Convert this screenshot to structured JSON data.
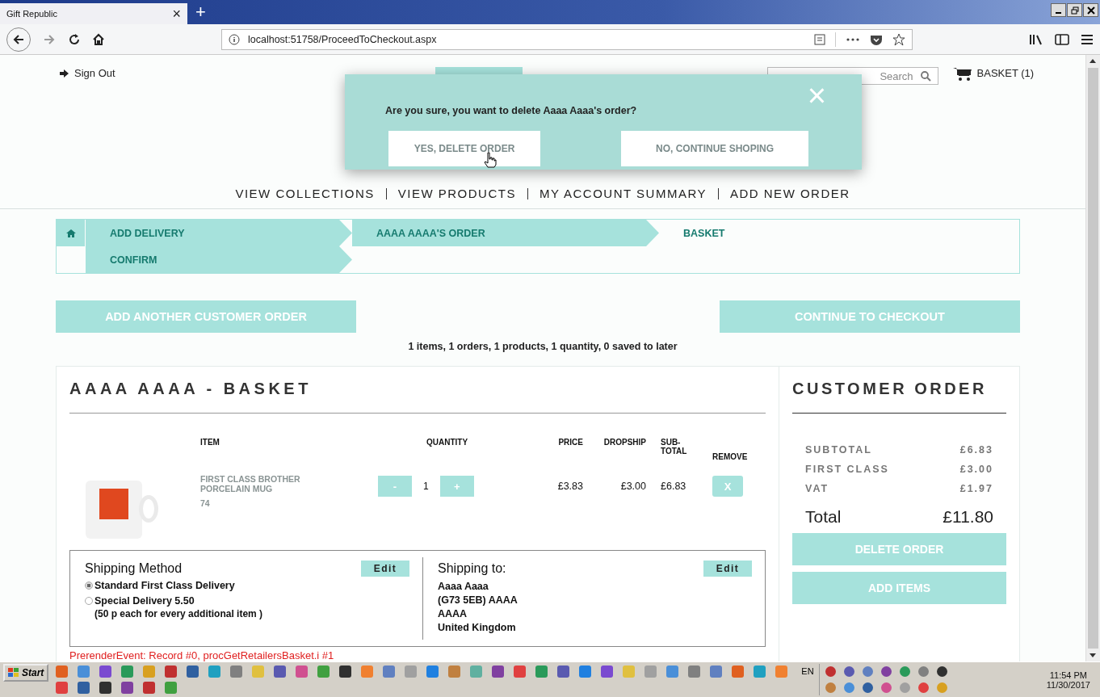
{
  "browser": {
    "tab": {
      "title": "Gift Republic",
      "close": "×"
    },
    "new_tab": "+",
    "url": "localhost:51758/ProceedToCheckout.aspx"
  },
  "header": {
    "sign_out": "Sign Out",
    "search": {
      "placeholder": "Search"
    },
    "basket": "BASKET (1)"
  },
  "dialog": {
    "message": "Are you sure, you want to delete Aaaa Aaaa's order?",
    "close": "×",
    "buttons": [
      "YES, DELETE ORDER",
      "NO, CONTINUE SHOPING"
    ]
  },
  "nav": [
    "VIEW COLLECTIONS",
    "VIEW PRODUCTS",
    "MY ACCOUNT SUMMARY",
    "ADD NEW ORDER"
  ],
  "breadcrumb": [
    {
      "label": "ADD DELIVERY",
      "selected": false
    },
    {
      "label": "AAAA AAAA'S ORDER",
      "selected": false
    },
    {
      "label": "BASKET",
      "selected": true
    },
    {
      "label": "CONFIRM",
      "selected": false
    }
  ],
  "actions": [
    "ADD ANOTHER CUSTOMER ORDER",
    "CONTINUE TO CHECKOUT"
  ],
  "summary": "1 items, 1 orders, 1 products, 1 quantity, 0 saved to later",
  "basket": {
    "title": "AAAA AAAA - BASKET",
    "columns": [
      "ITEM",
      "QUANTITY",
      "PRICE",
      "DROPSHIP",
      "SUB-TOTAL",
      "REMOVE"
    ],
    "rows": [
      {
        "name": "FIRST CLASS BROTHER PORCELAIN MUG",
        "code": "74",
        "minus": "-",
        "quantity": "1",
        "plus": "+",
        "price": "£3.83",
        "dropship": "£3.00",
        "subtotal": "£6.83",
        "remove": "X"
      }
    ]
  },
  "shipping_method": {
    "title": "Shipping Method",
    "edit": "Edit",
    "options": [
      {
        "label": "Standard First Class Delivery",
        "selected": true
      },
      {
        "label": "Special Delivery 5.50",
        "note": "(50 p each for every additional item )",
        "selected": false
      }
    ]
  },
  "shipping_to": {
    "title": "Shipping to:",
    "edit": "Edit",
    "lines": [
      "Aaaa Aaaa",
      "(G73 5EB) AAAA",
      "AAAA",
      "United Kingdom"
    ]
  },
  "debug": "PrerenderEvent: Record #0, procGetRetailersBasket.i #1",
  "order": {
    "title": "CUSTOMER ORDER",
    "lines": [
      {
        "label": "SUBTOTAL",
        "value": "£6.83"
      },
      {
        "label": "FIRST CLASS",
        "value": "£3.00"
      },
      {
        "label": "VAT",
        "value": "£1.97"
      }
    ],
    "total_label": "Total",
    "total": "£11.80",
    "buttons": [
      "DELETE ORDER",
      "ADD ITEMS"
    ]
  },
  "taskbar": {
    "start": "Start",
    "language": "EN",
    "time": "11:54 PM",
    "date": "11/30/2017"
  }
}
